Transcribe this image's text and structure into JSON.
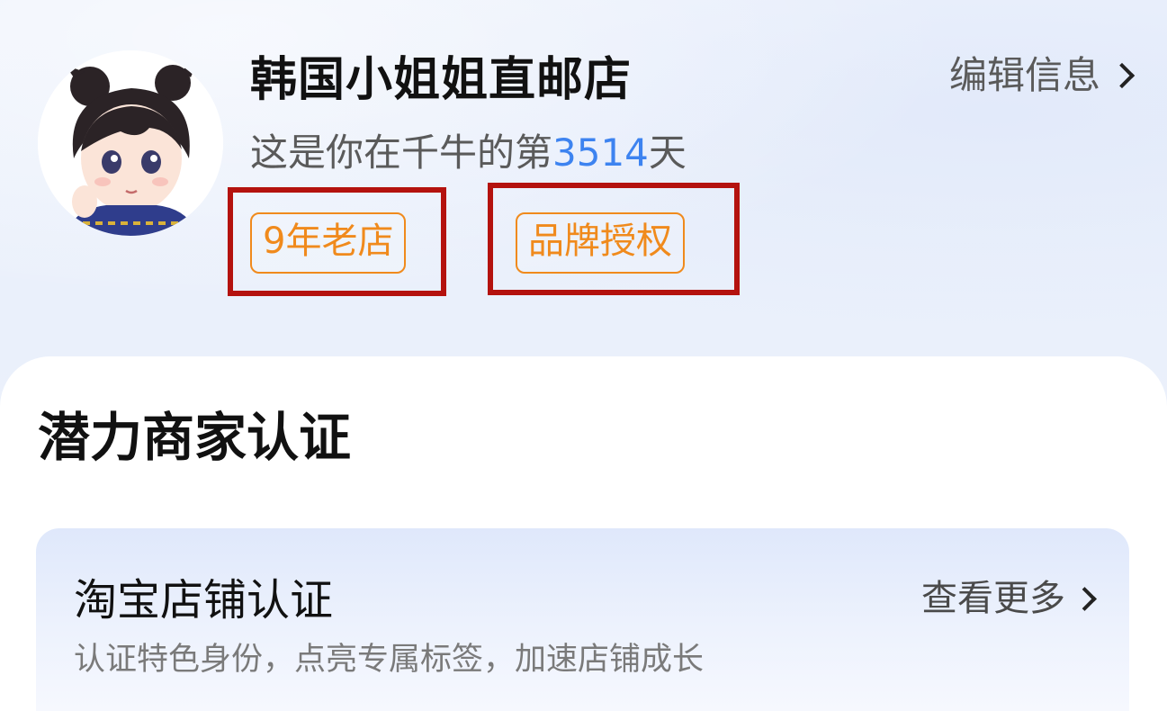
{
  "profile": {
    "shop_name": "韩国小姐姐直邮店",
    "days_prefix": "这是你在千牛的第",
    "days_count": "3514",
    "days_suffix": "天",
    "edit_label": "编辑信息",
    "tags": [
      {
        "label": "9年老店"
      },
      {
        "label": "品牌授权"
      }
    ],
    "avatar_icon": "cartoon-girl-avatar",
    "tag_color": "#f08a1c",
    "highlight_frame_color": "#b4120e",
    "days_color": "#3d83f0"
  },
  "section": {
    "title": "潜力商家认证",
    "card": {
      "title": "淘宝店铺认证",
      "description": "认证特色身份，点亮专属标签，加速店铺成长",
      "more_label": "查看更多"
    }
  }
}
